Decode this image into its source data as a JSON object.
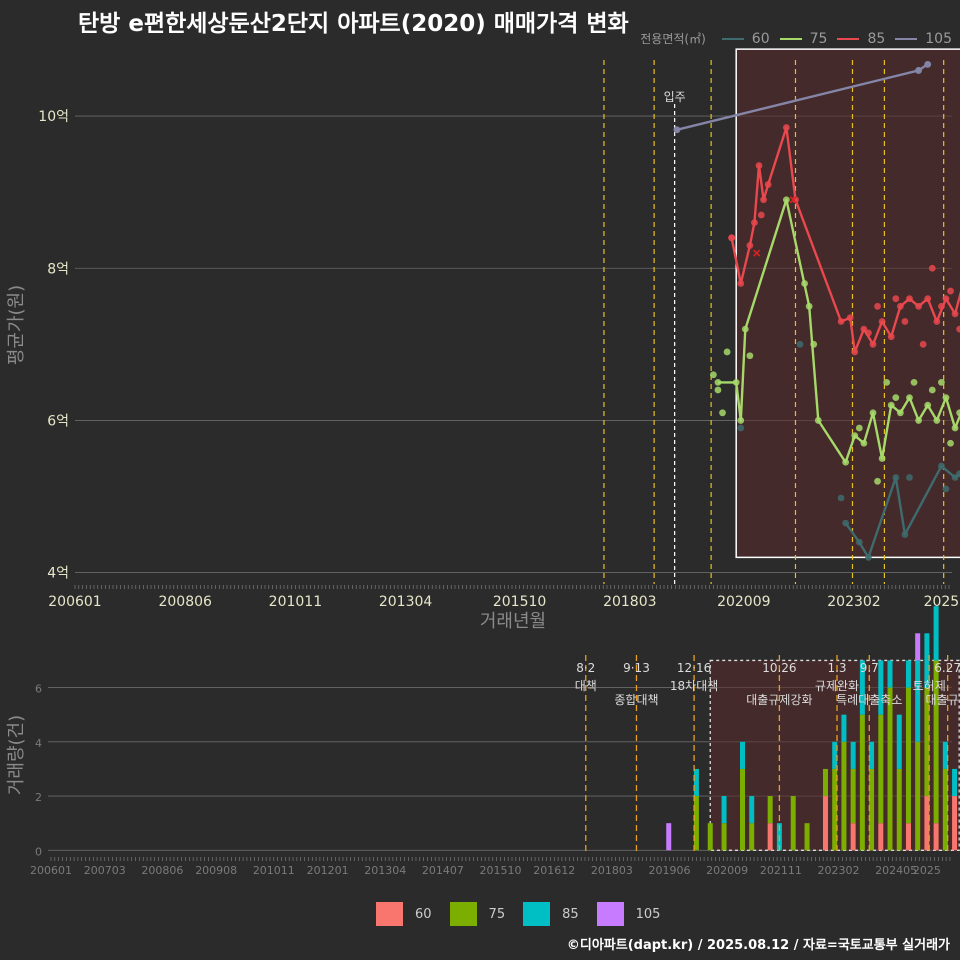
{
  "title": "탄방 e편한세상둔산2단지 아파트(2020) 매매가격 변화",
  "legend_title": "전용면적(㎡)",
  "footer": "©디아파트(dapt.kr) / 2025.08.12 / 자료=국토교통부 실거래가",
  "move_in_label": "입주",
  "colors": {
    "background": "#2b2b2b",
    "s60_line": "#3e6b6e",
    "s75_line": "#a6d96a",
    "s85_line": "#e8484e",
    "s105_line": "#8585a8",
    "b60": "#f8766d",
    "b75": "#7cae00",
    "b85": "#00bfc4",
    "b105": "#c77cff",
    "box": "#5a2a2a",
    "policy": "#e8c020"
  },
  "chart_data": [
    {
      "type": "line",
      "xlabel": "거래년월",
      "ylabel": "평균가(원)",
      "x_ticks": [
        "200601",
        "200806",
        "201011",
        "201304",
        "201510",
        "201803",
        "202009",
        "202302",
        "2025"
      ],
      "y_ticks": [
        {
          "v": 4,
          "label": "4억"
        },
        {
          "v": 6,
          "label": "6억"
        },
        {
          "v": 8,
          "label": "8억"
        },
        {
          "v": 10,
          "label": "10억"
        }
      ],
      "ylim": [
        3.85,
        11.0
      ],
      "legend": [
        "60",
        "75",
        "85",
        "105"
      ],
      "series": [
        {
          "name": "60",
          "color": "#3e6b6e",
          "line": [
            [
              2022.9,
              4.65
            ],
            [
              2023.2,
              4.4
            ],
            [
              2023.4,
              4.2
            ],
            [
              2024.0,
              5.25
            ],
            [
              2024.2,
              4.5
            ],
            [
              2025.0,
              5.4
            ],
            [
              2025.3,
              5.25
            ],
            [
              2025.6,
              5.35
            ]
          ],
          "points": [
            [
              2020.6,
              5.9
            ],
            [
              2021.9,
              7.0
            ],
            [
              2022.8,
              4.98
            ],
            [
              2024.3,
              5.25
            ],
            [
              2025.1,
              5.1
            ],
            [
              2025.4,
              5.3
            ]
          ]
        },
        {
          "name": "75",
          "color": "#a6d96a",
          "line": [
            [
              2020.1,
              6.5
            ],
            [
              2020.5,
              6.5
            ],
            [
              2020.6,
              6.0
            ],
            [
              2020.7,
              7.2
            ],
            [
              2021.6,
              8.9
            ],
            [
              2022.1,
              7.5
            ],
            [
              2022.3,
              6.0
            ],
            [
              2022.9,
              5.45
            ],
            [
              2023.1,
              5.8
            ],
            [
              2023.3,
              5.7
            ],
            [
              2023.5,
              6.1
            ],
            [
              2023.7,
              5.5
            ],
            [
              2023.9,
              6.2
            ],
            [
              2024.1,
              6.1
            ],
            [
              2024.3,
              6.3
            ],
            [
              2024.5,
              6.0
            ],
            [
              2024.7,
              6.2
            ],
            [
              2024.9,
              6.0
            ],
            [
              2025.1,
              6.3
            ],
            [
              2025.3,
              5.9
            ],
            [
              2025.5,
              6.2
            ]
          ],
          "points": [
            [
              2020.0,
              6.6
            ],
            [
              2020.1,
              6.4
            ],
            [
              2020.2,
              6.1
            ],
            [
              2020.3,
              6.9
            ],
            [
              2020.8,
              6.85
            ],
            [
              2022.0,
              7.8
            ],
            [
              2022.2,
              7.0
            ],
            [
              2023.2,
              5.9
            ],
            [
              2023.6,
              5.2
            ],
            [
              2023.8,
              6.5
            ],
            [
              2024.0,
              6.3
            ],
            [
              2024.4,
              6.5
            ],
            [
              2024.8,
              6.4
            ],
            [
              2025.0,
              6.5
            ],
            [
              2025.2,
              5.7
            ],
            [
              2025.4,
              6.1
            ],
            [
              2025.6,
              6.15
            ]
          ]
        },
        {
          "name": "85",
          "color": "#e8484e",
          "line": [
            [
              2020.4,
              8.4
            ],
            [
              2020.6,
              7.8
            ],
            [
              2020.8,
              8.3
            ],
            [
              2020.9,
              8.6
            ],
            [
              2021.0,
              9.35
            ],
            [
              2021.1,
              8.9
            ],
            [
              2021.2,
              9.1
            ],
            [
              2021.6,
              9.85
            ],
            [
              2021.8,
              8.9
            ],
            [
              2022.8,
              7.3
            ],
            [
              2023.0,
              7.35
            ],
            [
              2023.1,
              6.9
            ],
            [
              2023.3,
              7.2
            ],
            [
              2023.5,
              7.0
            ],
            [
              2023.7,
              7.3
            ],
            [
              2023.9,
              7.1
            ],
            [
              2024.1,
              7.5
            ],
            [
              2024.3,
              7.6
            ],
            [
              2024.5,
              7.5
            ],
            [
              2024.7,
              7.6
            ],
            [
              2024.9,
              7.3
            ],
            [
              2025.1,
              7.6
            ],
            [
              2025.3,
              7.4
            ],
            [
              2025.5,
              7.85
            ],
            [
              2025.7,
              7.6
            ]
          ],
          "points": [
            [
              2020.4,
              8.4
            ],
            [
              2021.05,
              8.7
            ],
            [
              2023.4,
              7.15
            ],
            [
              2023.6,
              7.5
            ],
            [
              2024.0,
              7.6
            ],
            [
              2024.2,
              7.3
            ],
            [
              2024.6,
              7.0
            ],
            [
              2024.8,
              8.0
            ],
            [
              2025.0,
              7.5
            ],
            [
              2025.2,
              7.7
            ],
            [
              2025.4,
              7.2
            ]
          ],
          "crosses": [
            [
              2020.95,
              8.2
            ],
            [
              2021.75,
              8.9
            ]
          ]
        },
        {
          "name": "105",
          "color": "#8585a8",
          "line": [
            [
              2019.2,
              9.82
            ],
            [
              2024.5,
              10.6
            ],
            [
              2024.7,
              10.68
            ]
          ],
          "points": [
            [
              2019.2,
              9.82
            ],
            [
              2024.5,
              10.6
            ],
            [
              2024.7,
              10.68
            ]
          ]
        }
      ]
    },
    {
      "type": "bar",
      "xlabel": "",
      "ylabel": "거래량(건)",
      "x_ticks": [
        "200601",
        "200703",
        "200806",
        "200908",
        "201011",
        "201201",
        "201304",
        "201407",
        "201510",
        "201612",
        "201803",
        "201906",
        "202009",
        "202111",
        "202302",
        "202405",
        "2025"
      ],
      "y_ticks": [
        0,
        2,
        4,
        6
      ],
      "ylim": [
        -0.1,
        7.2
      ],
      "legend": [
        "60",
        "75",
        "85",
        "105"
      ],
      "bars": [
        {
          "x": 2019.4,
          "s105": 1
        },
        {
          "x": 2020.0,
          "s75": 2,
          "s85": 1
        },
        {
          "x": 2020.3,
          "s75": 1
        },
        {
          "x": 2020.6,
          "s75": 1,
          "s85": 1
        },
        {
          "x": 2021.0,
          "s75": 3,
          "s85": 1
        },
        {
          "x": 2021.2,
          "s75": 1,
          "s85": 1
        },
        {
          "x": 2021.6,
          "s60": 1,
          "s75": 1
        },
        {
          "x": 2021.8,
          "s85": 1
        },
        {
          "x": 2022.1,
          "s75": 2
        },
        {
          "x": 2022.4,
          "s75": 1
        },
        {
          "x": 2022.8,
          "s60": 2,
          "s75": 1
        },
        {
          "x": 2023.0,
          "s75": 3,
          "s85": 1
        },
        {
          "x": 2023.2,
          "s75": 4,
          "s85": 1
        },
        {
          "x": 2023.4,
          "s60": 1,
          "s75": 2,
          "s85": 1
        },
        {
          "x": 2023.6,
          "s75": 5,
          "s85": 2
        },
        {
          "x": 2023.8,
          "s75": 3,
          "s85": 1
        },
        {
          "x": 2024.0,
          "s60": 1,
          "s75": 4,
          "s85": 2
        },
        {
          "x": 2024.2,
          "s75": 6,
          "s85": 1
        },
        {
          "x": 2024.4,
          "s75": 3,
          "s85": 2
        },
        {
          "x": 2024.6,
          "s60": 1,
          "s75": 5,
          "s85": 1
        },
        {
          "x": 2024.8,
          "s75": 4,
          "s85": 3,
          "s105": 1
        },
        {
          "x": 2025.0,
          "s60": 2,
          "s75": 4,
          "s85": 2
        },
        {
          "x": 2025.2,
          "s60": 1,
          "s75": 6,
          "s85": 2
        },
        {
          "x": 2025.4,
          "s75": 3,
          "s85": 1
        },
        {
          "x": 2025.6,
          "s60": 2,
          "s85": 1
        }
      ]
    }
  ],
  "policies": [
    {
      "x": 2017.6,
      "date": "8·2",
      "name": "대책"
    },
    {
      "x": 2018.7,
      "date": "9·13",
      "name": "종합대책"
    },
    {
      "x": 2019.95,
      "date": "12·16",
      "name": "18차대책"
    },
    {
      "x": 2021.8,
      "date": "10.26",
      "name": "대출규제강화"
    },
    {
      "x": 2023.05,
      "date": "1.3",
      "name": "규제완화"
    },
    {
      "x": 2023.75,
      "date": "9.7",
      "name": "특례대출축소"
    },
    {
      "x": 2025.05,
      "date": "",
      "name": "토허제"
    },
    {
      "x": 2025.45,
      "date": "6.27",
      "name": "대출규제"
    }
  ]
}
